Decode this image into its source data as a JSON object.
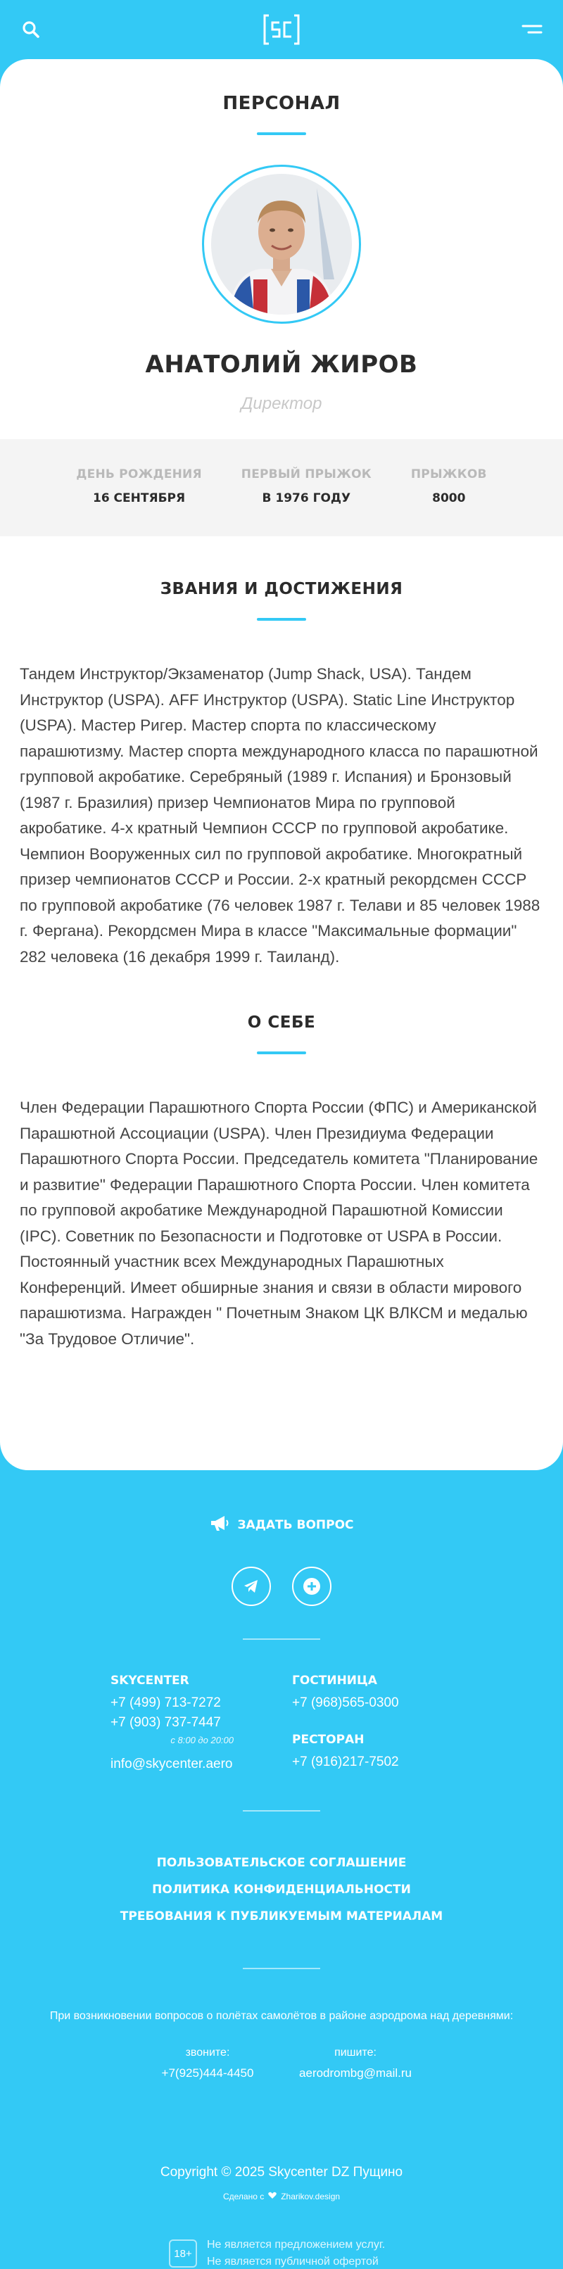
{
  "header": {
    "logo_text": "SC"
  },
  "staff": {
    "section_title": "Персонал"
  },
  "person": {
    "name": "Анатолий Жиров",
    "role": "Директор"
  },
  "stats": [
    {
      "label": "День рождения",
      "value": "16 сентября"
    },
    {
      "label": "Первый прыжок",
      "value": "в 1976 году"
    },
    {
      "label": "Прыжков",
      "value": "8000"
    }
  ],
  "achievements": {
    "title": "Звания и достижения",
    "text": "Тандем Инструктор/Экзаменатор (Jump Shack, USA). Тандем Инструктор (USPA). AFF Инструктор (USPA). Static Line Инструктор (USPA). Мастер Ригер. Мастер спорта по классическому парашютизму. Мастер спорта международного класса по парашютной групповой акробатике. Серебряный (1989 г. Испания) и Бронзовый (1987 г. Бразилия) призер Чемпионатов Мира по групповой акробатике. 4-х кратный Чемпион СССР по групповой акробатике. Чемпион Вооруженных сил по групповой акробатике. Многократный призер чемпионатов СССР и России. 2-х кратный рекордсмен СССР по групповой акробатике (76 человек 1987 г. Телави и 85 человек 1988 г. Фергана). Рекордсмен Мира в классе \"Максимальные формации\" 282 человека (16 декабря 1999 г. Таиланд)."
  },
  "about": {
    "title": "О себе",
    "text": "Член Федерации Парашютного Спорта России (ФПС) и Американской Парашютной Ассоциации (USPA). Член Президиума Федерации Парашютного Спорта России. Председатель комитета \"Планирование и развитие\" Федерации Парашютного Спорта России. Член комитета по групповой акробатике Международной Парашютной Комиссии (IPC). Советник по Безопасности и Подготовке от USPA в России. Постоянный участник всех Международных Парашютных Конференций. Имеет обширные знания и связи в области мирового парашютизма. Награжден \" Почетным Знаком ЦК ВЛКСМ и медалью \"За Трудовое Отличие\"."
  },
  "footer": {
    "ask_label": "Задать вопрос",
    "skycenter": {
      "heading": "Skycenter",
      "phone1": "+7 (499) 713-7272",
      "phone2": "+7 (903) 737-7447",
      "hours": "с 8:00 до 20:00",
      "email": "info@skycenter.aero"
    },
    "hotel": {
      "heading": "Гостиница",
      "phone": "+7 (968)565-0300"
    },
    "restaurant": {
      "heading": "Ресторан",
      "phone": "+7 (916)217-7502"
    },
    "links": [
      "Пользовательское соглашение",
      "Политика конфиденциальности",
      "Требования к публикуемым материалам"
    ],
    "aero": {
      "note": "При возникновении вопросов о полётах самолётов в районе аэродрома над деревнями:",
      "call_label": "звоните:",
      "call_value": "+7(925)444-4450",
      "write_label": "пишите:",
      "write_value": "aerodrombg@mail.ru"
    },
    "copyright": "Copyright © 2025 Skycenter DZ Пущино",
    "made_prefix": "Сделано с",
    "made_by": "Zharikov.design",
    "age_badge": "18+",
    "age_line1": "Не является предложением услуг.",
    "age_line2": "Не является публичной офертой"
  },
  "colors": {
    "accent": "#33c9f5",
    "stats_bg": "#f4f4f4"
  },
  "icons": [
    "search-icon",
    "menu-icon",
    "megaphone-icon",
    "telegram-icon",
    "plus-icon",
    "heart-icon"
  ]
}
